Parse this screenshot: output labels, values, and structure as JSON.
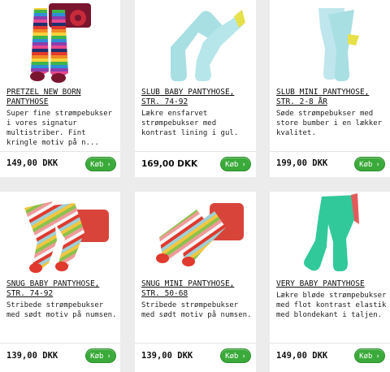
{
  "products": [
    {
      "title": "PRETZEL NEW BORN\nPANTYHOSE",
      "desc": "Super fine strømpebukser i vores signatur multistriber. Fint kringle motiv på n...",
      "price": "149,00 DKK",
      "buy_label": "Køb"
    },
    {
      "title": "SLUB BABY PANTYHOSE,\nSTR. 74-92",
      "desc": "Lækre ensfarvet strømpebukser med kontrast lining i gul.",
      "price": "169,00 DKK",
      "buy_label": "Køb"
    },
    {
      "title": "SLUB MINI PANTYHOSE,\nSTR. 2-8 ÅR",
      "desc": "Søde strømpebukser med store bumber i en lækker kvalitet.",
      "price": "199,00 DKK",
      "buy_label": "Køb"
    },
    {
      "title": "SNUG BABY PANTYHOSE,\nSTR. 74-92",
      "desc": "Stribede strømpebukser med sødt motiv på numsen.",
      "price": "139,00 DKK",
      "buy_label": "Køb"
    },
    {
      "title": "SNUG MINI PANTYHOSE,\nSTR. 50-68",
      "desc": "Stribede strømpebukser med sødt motiv på numsen.",
      "price": "139,00 DKK",
      "buy_label": "Køb"
    },
    {
      "title": "VERY BABY PANTYHOSE",
      "desc": "Lækre bløde strømpebukser med flot kontrast elastik med blondekant i taljen.",
      "price": "149,00 DKK",
      "buy_label": "Køb"
    }
  ],
  "colors": {
    "buy_button": "#3aaa3a",
    "tights_light_blue": "#a8dfe3",
    "tights_mint": "#31c99a",
    "lining_yellow": "#e6e04a",
    "stripe_red": "#e0392d"
  }
}
